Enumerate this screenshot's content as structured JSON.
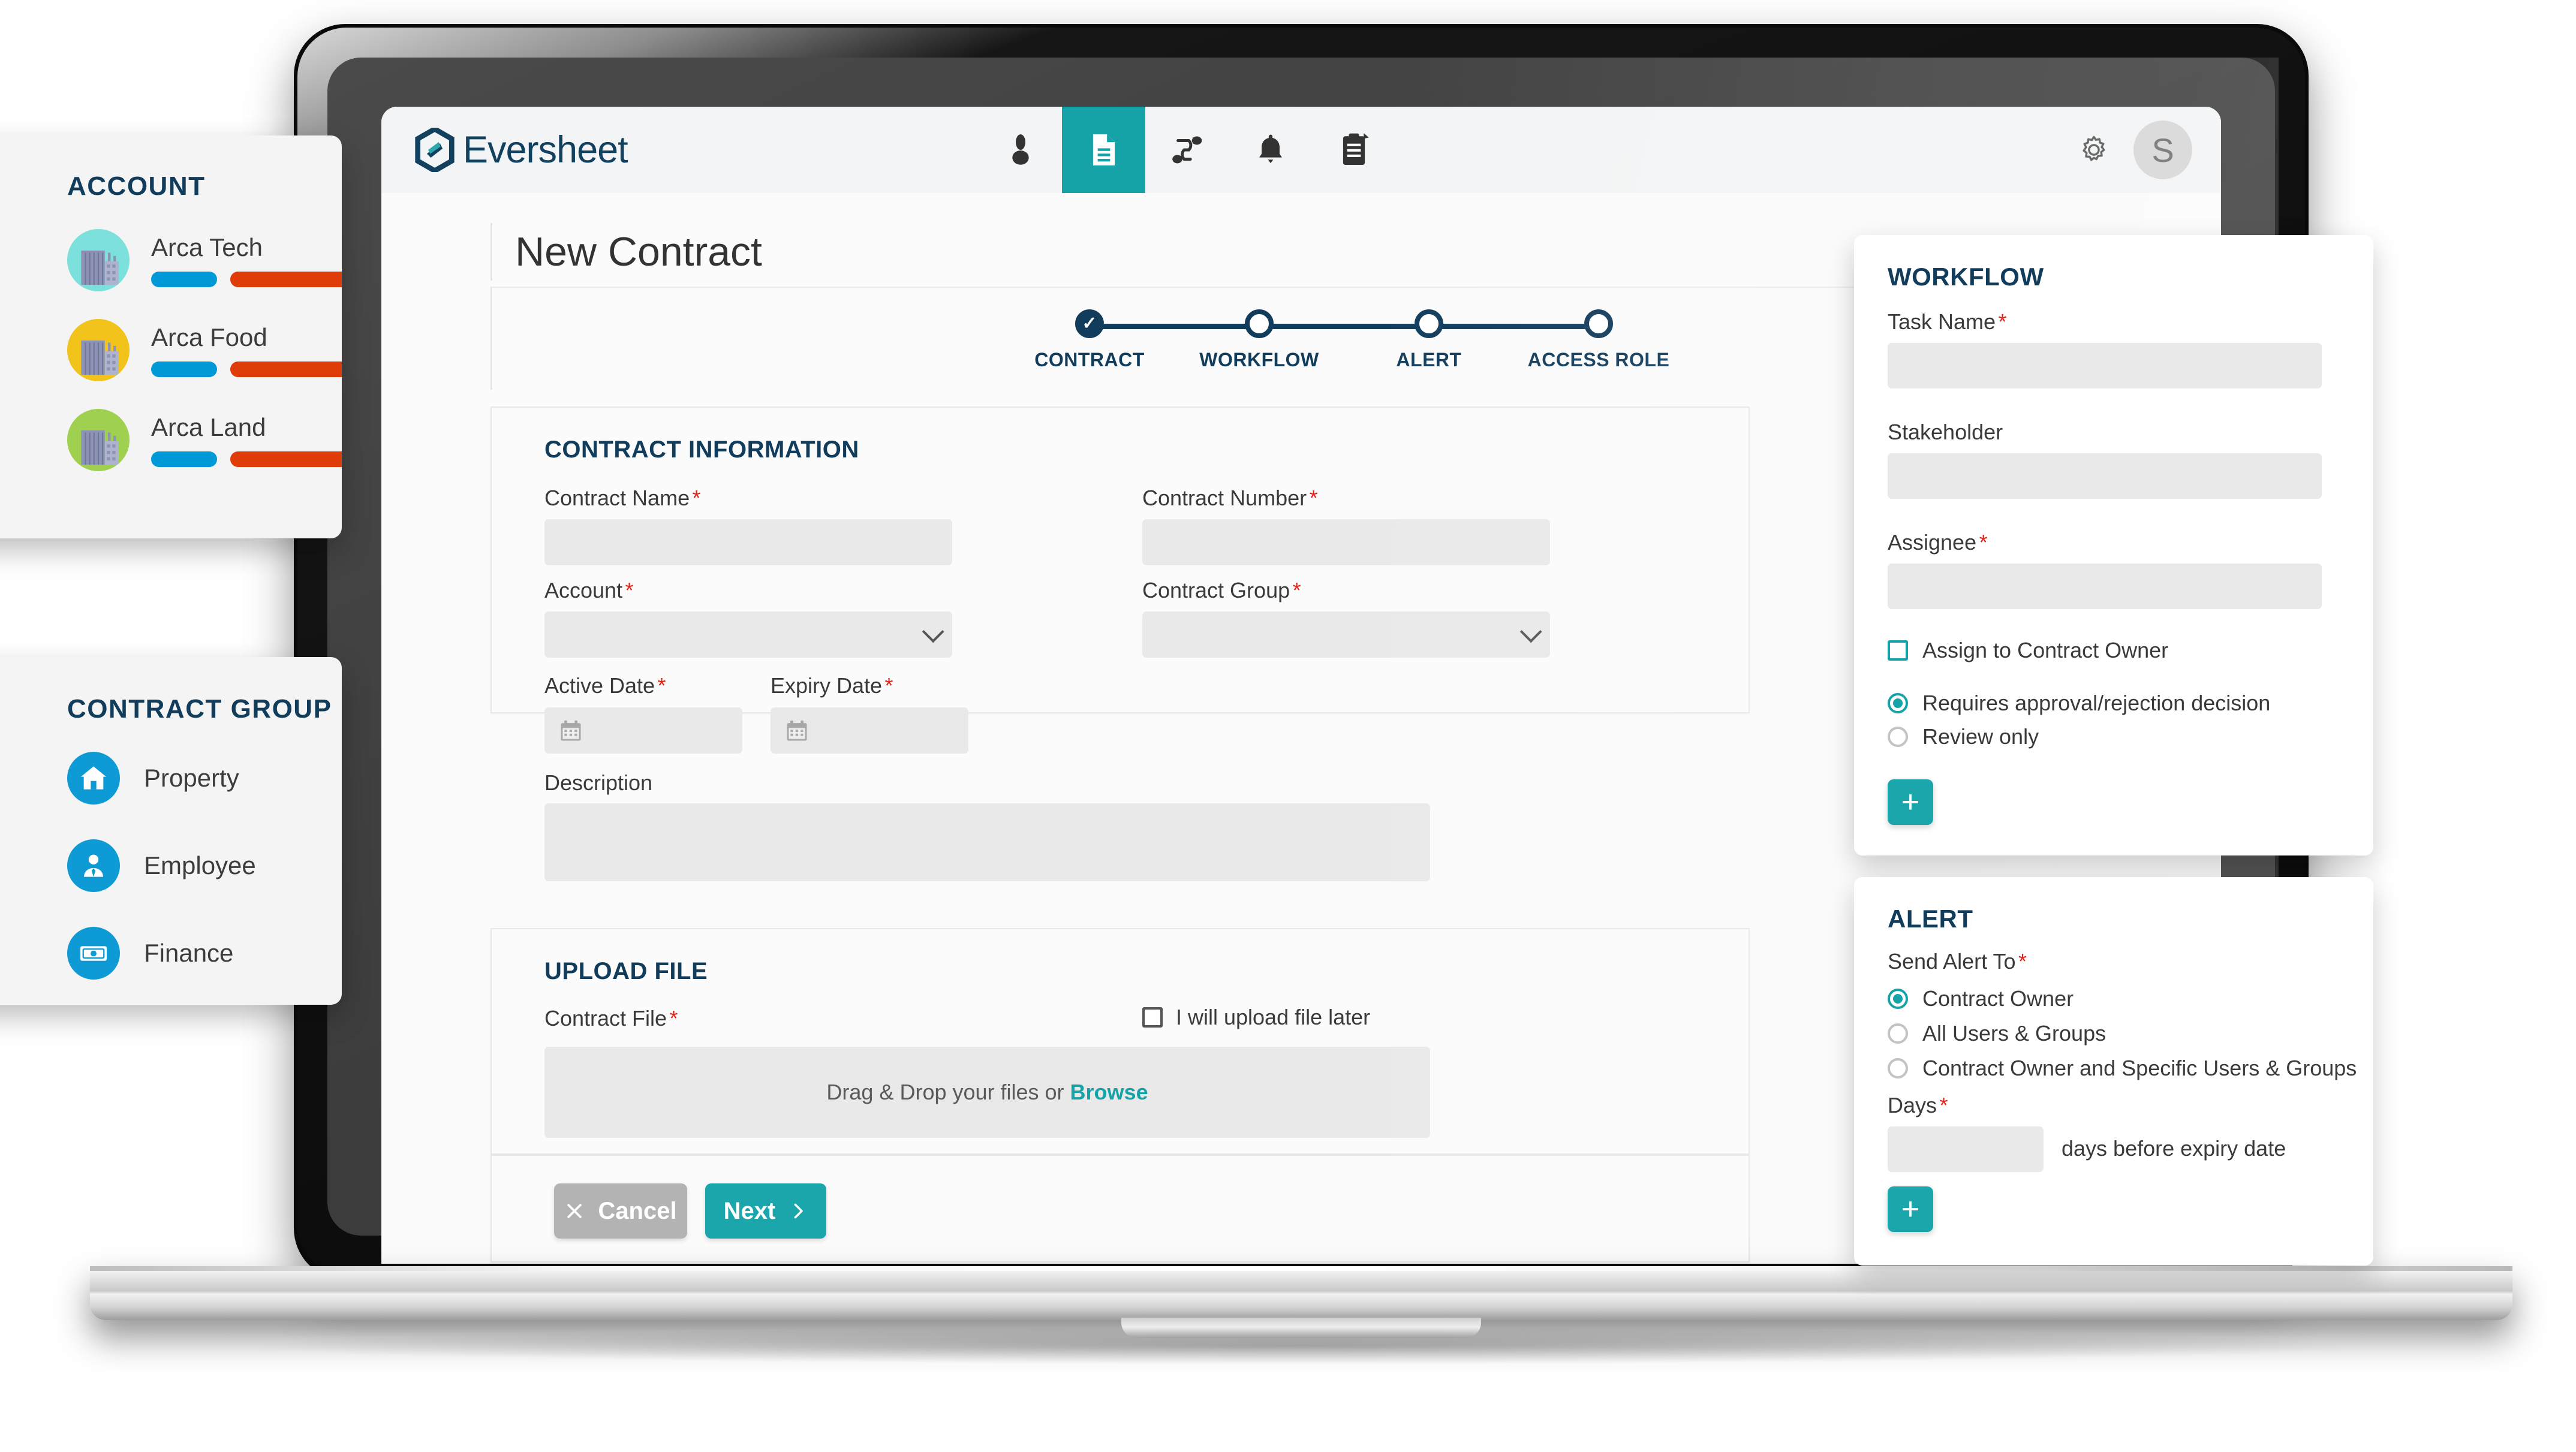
{
  "app": {
    "brand": "Eversheet",
    "avatar_initial": "S",
    "accent_teal": "#16a3a8",
    "accent_navy": "#123c5c",
    "accent_red": "#e2231a"
  },
  "nav": {
    "items": [
      {
        "icon": "user-icon",
        "label": "Users",
        "active": false
      },
      {
        "icon": "document-icon",
        "label": "Contracts",
        "active": true
      },
      {
        "icon": "workflow-icon",
        "label": "Workflow",
        "active": false
      },
      {
        "icon": "bell-icon",
        "label": "Alerts",
        "active": false
      },
      {
        "icon": "clipboard-icon",
        "label": "Reports",
        "active": false
      }
    ],
    "gear_icon": "gear-icon"
  },
  "page": {
    "title": "New Contract"
  },
  "stepper": {
    "steps": [
      {
        "label": "CONTRACT",
        "state": "done"
      },
      {
        "label": "WORKFLOW",
        "state": "pending"
      },
      {
        "label": "ALERT",
        "state": "pending"
      },
      {
        "label": "ACCESS ROLE",
        "state": "pending"
      }
    ]
  },
  "contract_information": {
    "heading": "CONTRACT INFORMATION",
    "contract_name_label": "Contract Name",
    "contract_name_value": "",
    "contract_number_label": "Contract Number",
    "contract_number_value": "",
    "account_label": "Account",
    "account_value": "",
    "contract_group_label": "Contract Group",
    "contract_group_value": "",
    "active_date_label": "Active Date",
    "active_date_value": "",
    "expiry_date_label": "Expiry Date",
    "expiry_date_value": "",
    "description_label": "Description",
    "description_value": "",
    "required_marker": "*"
  },
  "upload_file": {
    "heading": "UPLOAD FILE",
    "contract_file_label": "Contract File",
    "upload_later_label": "I will upload file later",
    "upload_later_checked": false,
    "drop_text": "Drag & Drop your files or",
    "browse_label": "Browse"
  },
  "footer": {
    "cancel_label": "Cancel",
    "cancel_icon": "close-icon",
    "next_label": "Next",
    "next_icon": "chevron-right-icon"
  },
  "workflow_panel": {
    "title": "WORKFLOW",
    "task_name_label": "Task Name",
    "task_name_value": "",
    "stakeholder_label": "Stakeholder",
    "stakeholder_value": "",
    "assignee_label": "Assignee",
    "assignee_value": "",
    "assign_owner_label": "Assign to Contract Owner",
    "assign_owner_checked": false,
    "decision_options": [
      {
        "label": "Requires approval/rejection decision",
        "selected": true
      },
      {
        "label": "Review only",
        "selected": false
      }
    ],
    "add_label": "+"
  },
  "alert_panel": {
    "title": "ALERT",
    "send_alert_to_label": "Send Alert To",
    "send_alert_options": [
      {
        "label": "Contract Owner",
        "selected": true
      },
      {
        "label": "All Users & Groups",
        "selected": false
      },
      {
        "label": "Contract Owner and Specific Users & Groups",
        "selected": false
      }
    ],
    "days_label": "Days",
    "days_value": "",
    "days_suffix": "days before expiry date",
    "add_label": "+"
  },
  "account_card": {
    "title": "ACCOUNT",
    "items": [
      {
        "name": "Arca Tech",
        "circle_color": "#7ce0dc",
        "bar1_color": "#0099d8",
        "bar2_color": "#e03c0a"
      },
      {
        "name": "Arca Food",
        "circle_color": "#f2c31a",
        "bar1_color": "#0099d8",
        "bar2_color": "#e03c0a"
      },
      {
        "name": "Arca Land",
        "circle_color": "#9fd04f",
        "bar1_color": "#0099d8",
        "bar2_color": "#e03c0a"
      }
    ]
  },
  "contract_group_card": {
    "title": "CONTRACT GROUP",
    "items": [
      {
        "name": "Property",
        "icon": "home-icon"
      },
      {
        "name": "Employee",
        "icon": "person-tie-icon"
      },
      {
        "name": "Finance",
        "icon": "banknote-icon"
      }
    ]
  }
}
